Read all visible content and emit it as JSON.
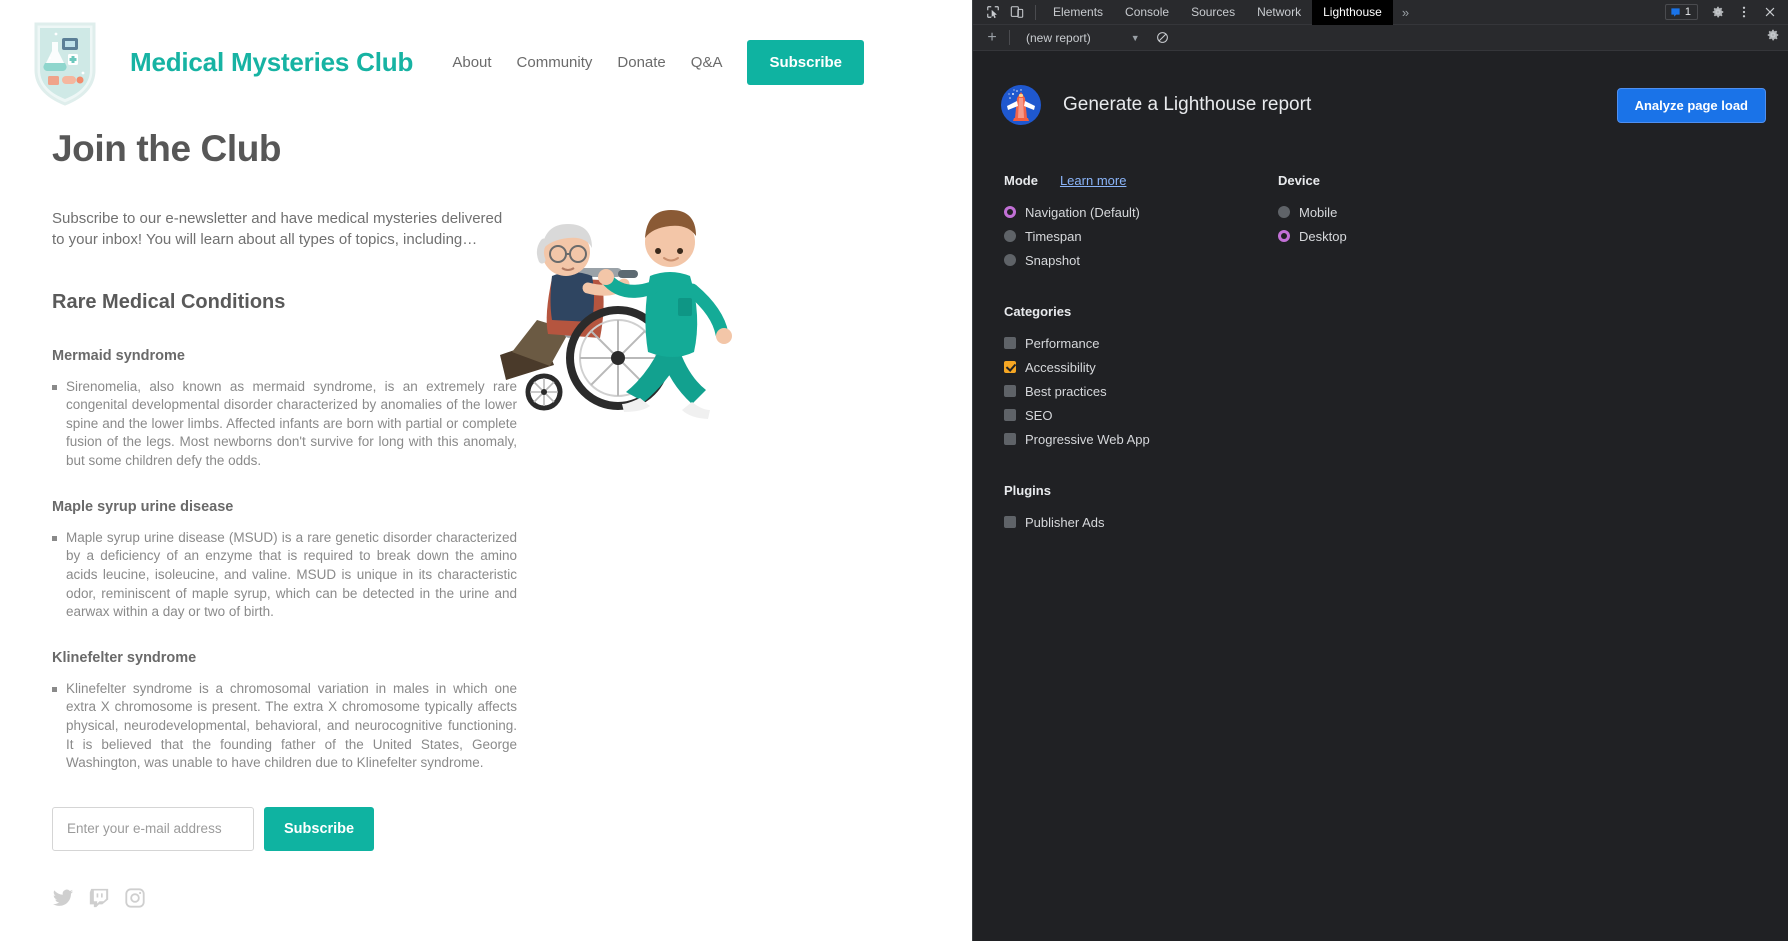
{
  "site": {
    "brand": "Medical Mysteries Club",
    "logo_icon": "shield-lab-logo",
    "nav": [
      {
        "label": "About"
      },
      {
        "label": "Community"
      },
      {
        "label": "Donate"
      },
      {
        "label": "Q&A"
      }
    ],
    "subscribe_button": "Subscribe",
    "hero_image_alt": "nurse-pushing-wheelchair-illustration",
    "brand_color": "#17b3a3",
    "accent_color": "#0fb3a1"
  },
  "main": {
    "title": "Join the Club",
    "intro": "Subscribe to our e-newsletter and have medical mysteries delivered to your inbox! You will learn about all types of topics, including…",
    "section_heading": "Rare Medical Conditions",
    "conditions": [
      {
        "name": "Mermaid syndrome",
        "description": "Sirenomelia, also known as mermaid syndrome, is an extremely rare congenital developmental disorder characterized by anomalies of the lower spine and the lower limbs. Affected infants are born with partial or complete fusion of the legs. Most newborns don't survive for long with this anomaly, but some children defy the odds."
      },
      {
        "name": "Maple syrup urine disease",
        "description": "Maple syrup urine disease (MSUD) is a rare genetic disorder characterized by a deficiency of an enzyme that is required to break down the amino acids leucine, isoleucine, and valine. MSUD is unique in its characteristic odor, reminiscent of maple syrup, which can be detected in the urine and earwax within a day or two of birth."
      },
      {
        "name": "Klinefelter syndrome",
        "description": "Klinefelter syndrome is a chromosomal variation in males in which one extra X chromosome is present. The extra X chromosome typically affects physical, neurodevelopmental, behavioral, and neurocognitive functioning. It is believed that the founding father of the United States, George Washington, was unable to have children due to Klinefelter syndrome."
      }
    ],
    "signup": {
      "email_placeholder": "Enter your e-mail address",
      "email_value": "",
      "submit_label": "Subscribe"
    },
    "social": [
      {
        "icon": "twitter-icon"
      },
      {
        "icon": "twitch-icon"
      },
      {
        "icon": "instagram-icon"
      }
    ]
  },
  "devtools": {
    "tabs": [
      {
        "label": "Elements",
        "active": false
      },
      {
        "label": "Console",
        "active": false
      },
      {
        "label": "Sources",
        "active": false
      },
      {
        "label": "Network",
        "active": false
      },
      {
        "label": "Lighthouse",
        "active": true
      }
    ],
    "more_tabs_label": "»",
    "issues_count": "1",
    "icons": {
      "inspect": "inspect-element-icon",
      "device": "device-toolbar-icon",
      "issues": "issues-icon",
      "settings": "gear-icon",
      "menu": "kebab-menu-icon",
      "close": "close-icon",
      "add_report": "+",
      "clear": "clear-icon",
      "toolbar_settings": "gear-icon"
    },
    "toolbar": {
      "report_select_value": "(new report)",
      "caret": "▼"
    },
    "lighthouse": {
      "logo_icon": "lighthouse-logo",
      "title": "Generate a Lighthouse report",
      "analyze_button": "Analyze page load",
      "mode": {
        "title": "Mode",
        "learn_more": "Learn more",
        "options": [
          {
            "label": "Navigation (Default)",
            "selected": true
          },
          {
            "label": "Timespan",
            "selected": false
          },
          {
            "label": "Snapshot",
            "selected": false
          }
        ]
      },
      "device": {
        "title": "Device",
        "options": [
          {
            "label": "Mobile",
            "selected": false
          },
          {
            "label": "Desktop",
            "selected": true
          }
        ]
      },
      "categories": {
        "title": "Categories",
        "options": [
          {
            "label": "Performance",
            "checked": false
          },
          {
            "label": "Accessibility",
            "checked": true
          },
          {
            "label": "Best practices",
            "checked": false
          },
          {
            "label": "SEO",
            "checked": false
          },
          {
            "label": "Progressive Web App",
            "checked": false
          }
        ]
      },
      "plugins": {
        "title": "Plugins",
        "options": [
          {
            "label": "Publisher Ads",
            "checked": false
          }
        ]
      },
      "colors": {
        "radio_selected": "#c270d6",
        "checkbox_checked": "#f5a623",
        "analyze_button": "#1a73e8",
        "link": "#8ab4f8"
      }
    }
  }
}
